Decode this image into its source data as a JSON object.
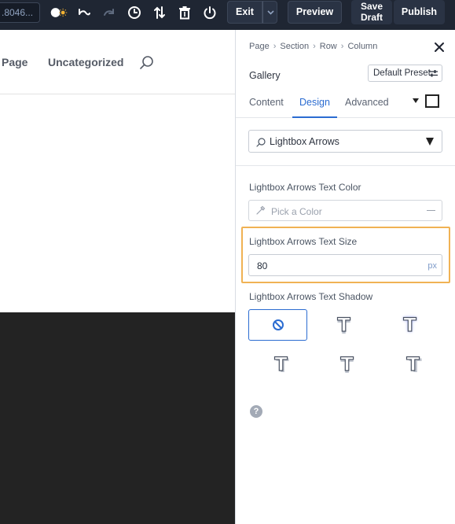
{
  "toolbar": {
    "url_text": ".8046...",
    "exit_label": "Exit",
    "preview_label": "Preview",
    "save_draft_line1": "Save",
    "save_draft_line2": "Draft",
    "publish_label": "Publish",
    "icons": [
      "mode-toggle-icon",
      "undo-icon",
      "redo-icon",
      "history-icon",
      "sort-icon",
      "trash-icon",
      "power-icon"
    ]
  },
  "site": {
    "nav_items": [
      "Page",
      "Uncategorized"
    ]
  },
  "panel": {
    "breadcrumb": [
      "Page",
      "Section",
      "Row",
      "Column"
    ],
    "module_name": "Gallery",
    "preset_label": "Default Preset",
    "tabs": [
      "Content",
      "Design",
      "Advanced"
    ],
    "active_tab": "Design",
    "search_value": "Lightbox Arrows",
    "color_label": "Lightbox Arrows Text Color",
    "color_placeholder": "Pick a Color",
    "size_label": "Lightbox Arrows Text Size",
    "size_value": "80",
    "size_unit": "px",
    "shadow_label": "Lightbox Arrows Text Shadow",
    "shadow_glyph": "T"
  },
  "colors": {
    "toolbar_bg": "#1f2633",
    "accent": "#2b6cd1",
    "highlight": "#f0b254",
    "dark_section": "#232323"
  }
}
